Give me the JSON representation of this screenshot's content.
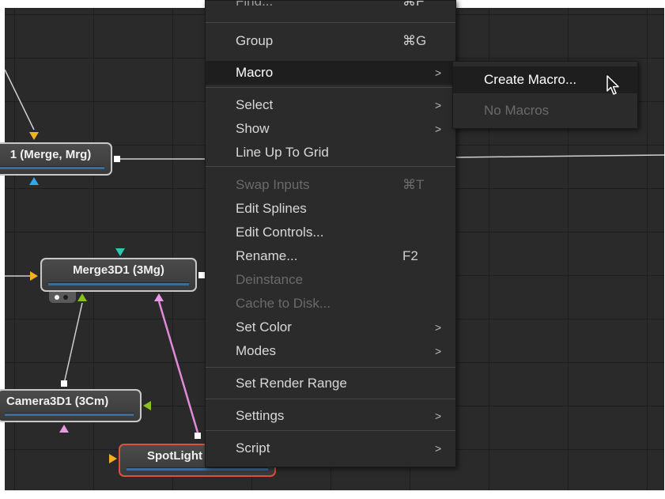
{
  "nodes": {
    "merge1": {
      "label": "1  (Merge, Mrg)"
    },
    "merge3d": {
      "label": "Merge3D1  (3Mg)"
    },
    "camera3d": {
      "label": "Camera3D1  (3Cm)"
    },
    "spotlight": {
      "label": "SpotLight"
    }
  },
  "context_menu": {
    "items": [
      {
        "label": "Find...",
        "shortcut": "⌘F",
        "state": "partial"
      },
      {
        "label": "Group",
        "shortcut": "⌘G"
      },
      {
        "label": "Macro",
        "submenu": true,
        "state": "active"
      },
      {
        "label": "Select",
        "submenu": true
      },
      {
        "label": "Show",
        "submenu": true
      },
      {
        "label": "Line Up To Grid"
      },
      {
        "label": "Swap Inputs",
        "shortcut": "⌘T",
        "state": "disabled"
      },
      {
        "label": "Edit Splines"
      },
      {
        "label": "Edit Controls..."
      },
      {
        "label": "Rename...",
        "shortcut": "F2"
      },
      {
        "label": "Deinstance",
        "state": "disabled"
      },
      {
        "label": "Cache to Disk...",
        "state": "disabled"
      },
      {
        "label": "Set Color",
        "submenu": true
      },
      {
        "label": "Modes",
        "submenu": true
      },
      {
        "label": "Set Render Range"
      },
      {
        "label": "Settings",
        "submenu": true
      },
      {
        "label": "Script",
        "submenu": true
      }
    ],
    "submenu_arrow": ">"
  },
  "macro_submenu": {
    "items": [
      {
        "label": "Create Macro...",
        "state": "active"
      },
      {
        "label": "No Macros",
        "state": "disabled"
      }
    ]
  },
  "colors": {
    "canvas": "#2a2a2a",
    "wire": "#d0d0d0",
    "wire_pink": "#e08ad8",
    "input_yellow": "#f2b21e",
    "input_blue": "#2fa8e8",
    "input_green": "#8bc21a",
    "input_teal": "#2cc9b0",
    "input_pink": "#e89ae6",
    "selected_border": "#d9533a",
    "menu_bg": "#2b2b2b",
    "menu_active": "#1e1e1e"
  }
}
